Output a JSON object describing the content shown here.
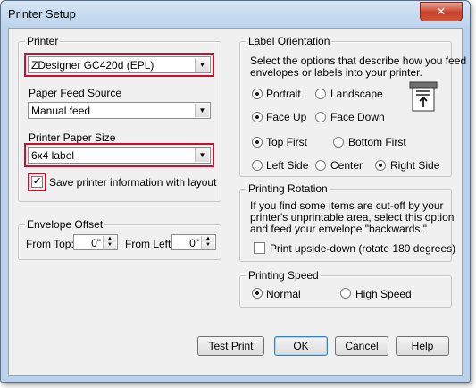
{
  "window": {
    "title": "Printer Setup",
    "close_glyph": "✕"
  },
  "printer": {
    "legend": "Printer",
    "selected": "ZDesigner GC420d (EPL)",
    "paper_feed_label": "Paper Feed Source",
    "paper_feed_value": "Manual feed",
    "paper_size_label": "Printer Paper Size",
    "paper_size_value": "6x4 label",
    "save_checkbox_label": "Save printer information with layout",
    "save_checked": true
  },
  "envelope_offset": {
    "legend": "Envelope Offset",
    "from_top_label": "From Top:",
    "from_top_value": "0\"",
    "from_left_label": "From Left:",
    "from_left_value": "0\""
  },
  "label_orientation": {
    "legend": "Label Orientation",
    "description_line1": "Select the options that describe how you feed",
    "description_line2": "envelopes or labels into your printer.",
    "portrait": "Portrait",
    "landscape": "Landscape",
    "face_up": "Face Up",
    "face_down": "Face Down",
    "top_first": "Top First",
    "bottom_first": "Bottom First",
    "left_side": "Left Side",
    "center": "Center",
    "right_side": "Right Side"
  },
  "printing_rotation": {
    "legend": "Printing Rotation",
    "line1": "If you find some items are cut-off by your",
    "line2": "printer's unprintable area, select this option",
    "line3": "and feed your envelope \"backwards.\"",
    "checkbox_label": "Print upside-down (rotate 180 degrees)",
    "checked": false
  },
  "printing_speed": {
    "legend": "Printing Speed",
    "normal": "Normal",
    "high": "High Speed"
  },
  "buttons": {
    "test_print": "Test Print",
    "ok": "OK",
    "cancel": "Cancel",
    "help": "Help"
  },
  "colors": {
    "highlight": "#c8102e",
    "dialog_bg": "#f0f0f0",
    "frame": "#b9d1ea"
  }
}
